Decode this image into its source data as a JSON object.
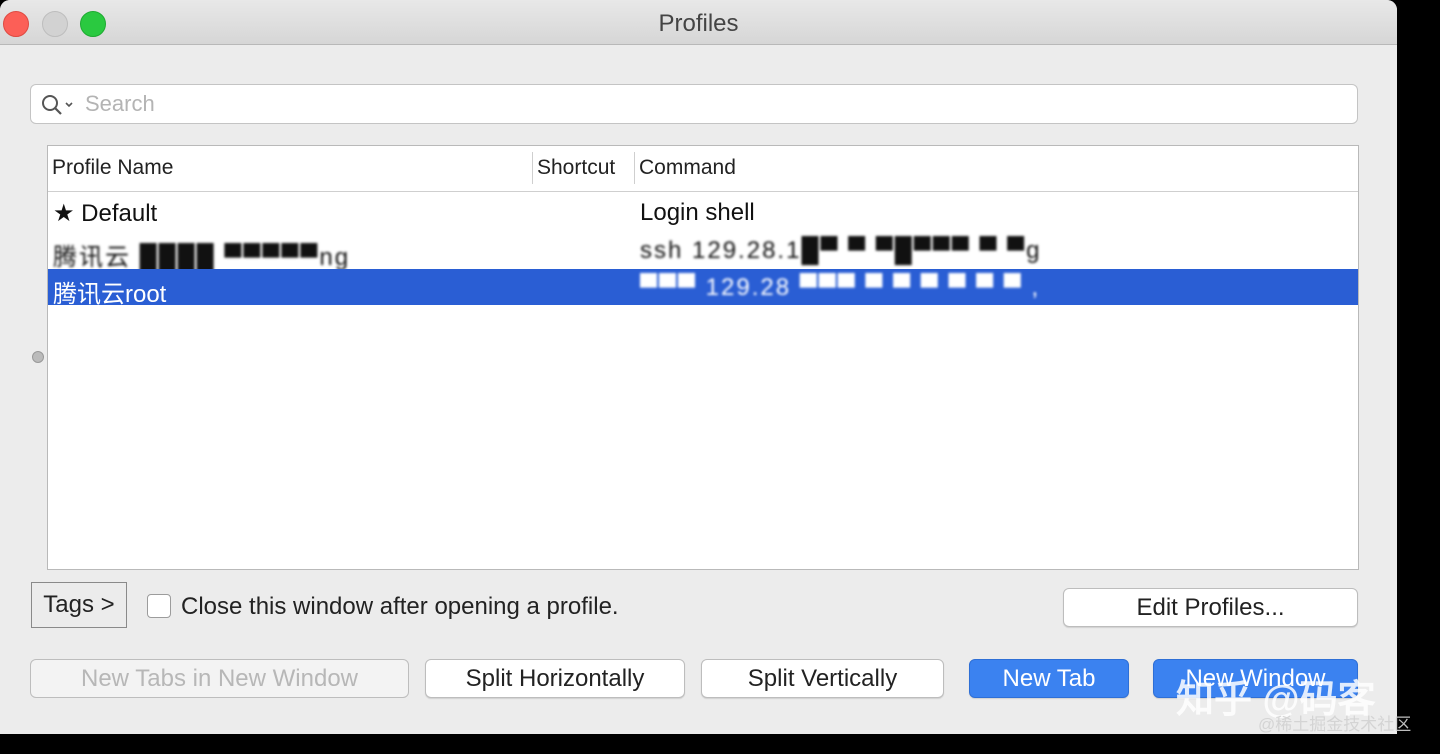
{
  "window": {
    "title": "Profiles"
  },
  "search": {
    "placeholder": "Search",
    "value": ""
  },
  "table": {
    "columns": [
      "Profile Name",
      "Shortcut",
      "Command"
    ],
    "rows": [
      {
        "name": "★ Default",
        "shortcut": "",
        "command": "Login shell",
        "selected": false
      },
      {
        "name": "腾讯云 ████ ▀▀▀▀▀ng",
        "shortcut": "",
        "command": "ssh 129.28.1█▀ ▀ ▀█▀▀▀ ▀ ▀g",
        "selected": false
      },
      {
        "name": "腾讯云root",
        "shortcut": "",
        "command": "▀▀▀ 129.28 ▀▀▀ ▀ ▀ ▀ ▀ ▀ ▀ ,",
        "selected": true
      }
    ]
  },
  "footer": {
    "tags_label": "Tags >",
    "close_window_label": "Close this window after opening a profile.",
    "close_window_checked": false,
    "edit_profiles_label": "Edit Profiles...",
    "buttons": {
      "new_tabs_in_new_window": "New Tabs in New Window",
      "split_horizontally": "Split Horizontally",
      "split_vertically": "Split Vertically",
      "new_tab": "New Tab",
      "new_window": "New Window"
    }
  },
  "watermark": {
    "main": "知乎 @码客",
    "sub": "@稀土掘金技术社区"
  },
  "colors": {
    "selection": "#2a5ed4",
    "primary_button": "#3b82f0"
  }
}
